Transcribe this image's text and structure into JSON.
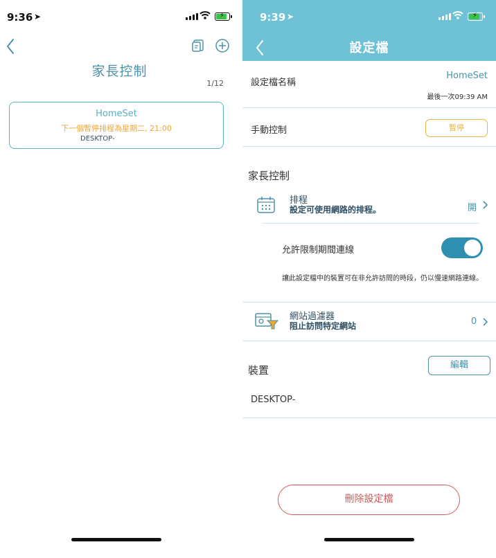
{
  "colors": {
    "accent": "#4b93a9",
    "header": "#6fc1d6",
    "warning": "#f0a531",
    "danger": "#cf5b5b",
    "toggle_on": "#2f8fb0"
  },
  "left": {
    "status_time": "9:36",
    "title": "家長控制",
    "page_count": "1/12",
    "profile_card": {
      "name": "HomeSet",
      "schedule_note": "下一個暫停排程為星期二, 21:00",
      "device": "DESKTOP-"
    }
  },
  "right": {
    "status_time": "9:39",
    "title": "設定檔",
    "profile_name_label": "設定檔名稱",
    "profile_name_value": "HomeSet",
    "last_updated": "最後一次09:39 AM",
    "manual_control_label": "手動控制",
    "pause_button": "暫停",
    "parental_section": "家長控制",
    "schedule": {
      "title": "排程",
      "subtitle": "設定可使用網路的排程。",
      "value": "開"
    },
    "allow_during_limit": {
      "label": "允許限制期間連線",
      "enabled": true
    },
    "allow_note": "讓此設定檔中的裝置可在非允許訪問的時段，仍以慢速網路連線。",
    "web_filter": {
      "title": "網站過濾器",
      "subtitle": "阻止訪問特定網站",
      "value": "0"
    },
    "devices_section": "裝置",
    "edit_button": "編輯",
    "device_name": "DESKTOP-",
    "delete_button": "刪除設定檔"
  },
  "icons": [
    "location-arrow-icon",
    "signal-icon",
    "wifi-icon",
    "battery-icon",
    "back-chevron-icon",
    "profile-switch-icon",
    "add-circle-icon",
    "calendar-icon",
    "web-filter-icon",
    "chevron-right-icon"
  ]
}
